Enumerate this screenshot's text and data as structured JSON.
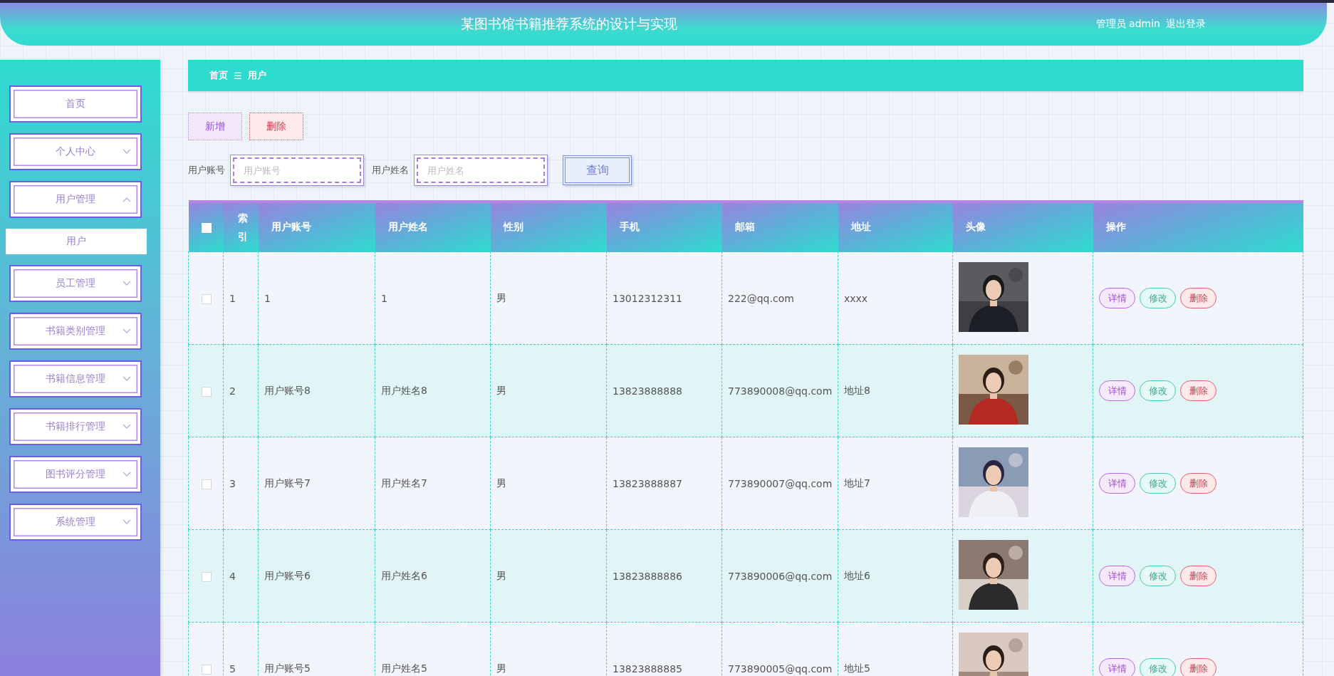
{
  "header": {
    "title": "某图书馆书籍推荐系统的设计与实现",
    "user": "管理员 admin",
    "logout": "退出登录"
  },
  "sidebar": {
    "items": [
      {
        "label": "首页",
        "kind": "link"
      },
      {
        "label": "个人中心",
        "kind": "group",
        "expanded": false
      },
      {
        "label": "用户管理",
        "kind": "group",
        "expanded": true,
        "children": [
          {
            "label": "用户",
            "selected": true
          }
        ]
      },
      {
        "label": "员工管理",
        "kind": "group",
        "expanded": false
      },
      {
        "label": "书籍类别管理",
        "kind": "group",
        "expanded": false
      },
      {
        "label": "书籍信息管理",
        "kind": "group",
        "expanded": false
      },
      {
        "label": "书籍排行管理",
        "kind": "group",
        "expanded": false
      },
      {
        "label": "图书评分管理",
        "kind": "group",
        "expanded": false
      },
      {
        "label": "系统管理",
        "kind": "group",
        "expanded": false
      }
    ]
  },
  "breadcrumb": {
    "items": [
      "首页",
      "用户"
    ],
    "separator": "☰"
  },
  "actions": [
    {
      "label": "新增",
      "kind": "add"
    },
    {
      "label": "删除",
      "kind": "delete"
    }
  ],
  "search": {
    "fields": [
      {
        "label": "用户账号",
        "placeholder": "用户账号"
      },
      {
        "label": "用户姓名",
        "placeholder": "用户姓名"
      }
    ],
    "button": "查询"
  },
  "table": {
    "select_all": {
      "checked": false
    },
    "columns": [
      "索引",
      "用户账号",
      "用户姓名",
      "性别",
      "手机",
      "邮箱",
      "地址",
      "头像",
      "操作"
    ],
    "rows": [
      {
        "checked": false,
        "cells": [
          "1",
          "1",
          "1",
          "男",
          "13012312311",
          "222@qq.com",
          "xxxx"
        ],
        "buttons": [
          {
            "label": "详情",
            "kind": "detail"
          },
          {
            "label": "修改",
            "kind": "edit"
          },
          {
            "label": "删除",
            "kind": "delete"
          }
        ]
      },
      {
        "checked": false,
        "cells": [
          "2",
          "用户账号8",
          "用户姓名8",
          "男",
          "13823888888",
          "773890008@qq.com",
          "地址8"
        ],
        "buttons": [
          {
            "label": "详情",
            "kind": "detail"
          },
          {
            "label": "修改",
            "kind": "edit"
          },
          {
            "label": "删除",
            "kind": "delete"
          }
        ]
      },
      {
        "checked": false,
        "cells": [
          "3",
          "用户账号7",
          "用户姓名7",
          "男",
          "13823888887",
          "773890007@qq.com",
          "地址7"
        ],
        "buttons": [
          {
            "label": "详情",
            "kind": "detail"
          },
          {
            "label": "修改",
            "kind": "edit"
          },
          {
            "label": "删除",
            "kind": "delete"
          }
        ]
      },
      {
        "checked": false,
        "cells": [
          "4",
          "用户账号6",
          "用户姓名6",
          "男",
          "13823888886",
          "773890006@qq.com",
          "地址6"
        ],
        "buttons": [
          {
            "label": "详情",
            "kind": "detail"
          },
          {
            "label": "修改",
            "kind": "edit"
          },
          {
            "label": "删除",
            "kind": "delete"
          }
        ]
      },
      {
        "checked": false,
        "cells": [
          "5",
          "用户账号5",
          "用户姓名5",
          "男",
          "13823888885",
          "773890005@qq.com",
          "地址5"
        ],
        "buttons": [
          {
            "label": "详情",
            "kind": "detail"
          },
          {
            "label": "修改",
            "kind": "edit"
          },
          {
            "label": "删除",
            "kind": "delete"
          }
        ]
      }
    ]
  }
}
